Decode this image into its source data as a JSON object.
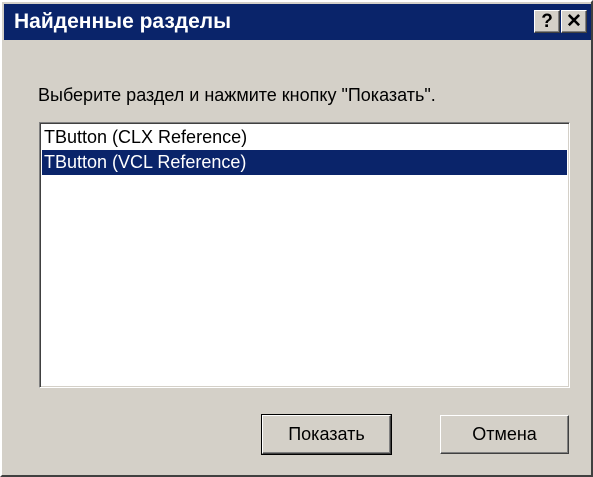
{
  "window": {
    "title": "Найденные разделы",
    "help_label": "?",
    "close_label": "✕"
  },
  "prompt": "Выберите раздел и нажмите кнопку \"Показать\".",
  "list": {
    "items": [
      {
        "label": "TButton  (CLX Reference)",
        "selected": false
      },
      {
        "label": "TButton  (VCL Reference)",
        "selected": true
      }
    ]
  },
  "buttons": {
    "show_label": "Показать",
    "cancel_label": "Отмена"
  },
  "colors": {
    "titlebar": "#0a246a",
    "face": "#d4d0c8",
    "selection": "#0a246a"
  }
}
